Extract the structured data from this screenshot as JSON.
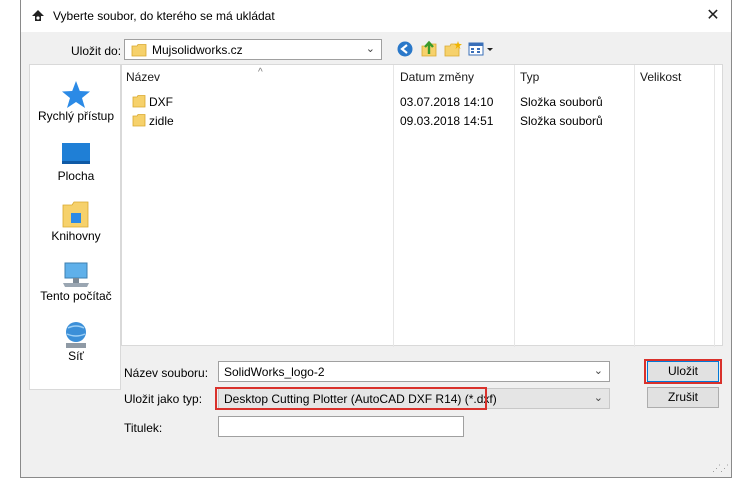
{
  "window": {
    "title": "Vyberte soubor, do kterého se má ukládat",
    "close_glyph": "✕"
  },
  "save_in": {
    "label": "Uložit do:",
    "value": "Mujsolidworks.cz"
  },
  "toolbar": {
    "icons": [
      "back-icon",
      "up-folder-icon",
      "new-folder-icon",
      "view-menu-icon"
    ]
  },
  "places": [
    {
      "label": "Rychlý přístup",
      "icon": "star-icon"
    },
    {
      "label": "Plocha",
      "icon": "desktop-icon"
    },
    {
      "label": "Knihovny",
      "icon": "libraries-icon"
    },
    {
      "label": "Tento počítač",
      "icon": "computer-icon"
    },
    {
      "label": "Síť",
      "icon": "network-icon"
    }
  ],
  "file_list": {
    "columns": [
      "Název",
      "Datum změny",
      "Typ",
      "Velikost"
    ],
    "sort_glyph": "^",
    "rows": [
      {
        "name": "DXF",
        "date": "03.07.2018 14:10",
        "type": "Složka souborů",
        "size": ""
      },
      {
        "name": "zidle",
        "date": "09.03.2018 14:51",
        "type": "Složka souborů",
        "size": ""
      }
    ]
  },
  "form": {
    "filename_label": "Název souboru:",
    "filename_value": "SolidWorks_logo-2",
    "savetype_label": "Uložit jako typ:",
    "savetype_value": "Desktop Cutting Plotter (AutoCAD DXF R14) (*.dxf)",
    "title_label": "Titulek:",
    "title_value": ""
  },
  "buttons": {
    "save": "Uložit",
    "cancel": "Zrušit"
  },
  "colors": {
    "highlight": "#d9312b",
    "folder": "#f6d16b",
    "accent": "#0078d7"
  }
}
